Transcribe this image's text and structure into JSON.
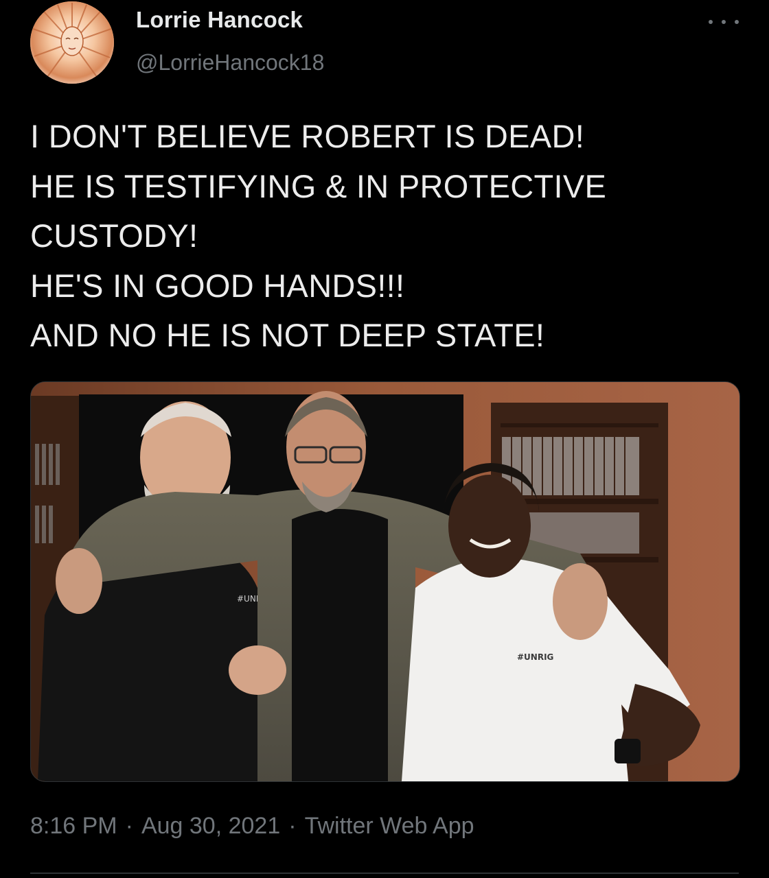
{
  "author": {
    "display_name": "Lorrie Hancock",
    "handle": "@LorrieHancock18",
    "avatar_icon": "woman-portrait-avatar"
  },
  "more_icon": "more-options-icon",
  "tweet": {
    "lines": [
      "I DON'T BELIEVE ROBERT IS DEAD!",
      "HE IS TESTIFYING & IN PROTECTIVE",
      "CUSTODY!",
      "HE'S IN GOOD HANDS!!!",
      "AND NO HE IS NOT DEEP STATE!"
    ]
  },
  "media": {
    "shirt_logo_left": "#UNRIG",
    "shirt_logo_right": "#UNRIG"
  },
  "meta": {
    "time": "8:16 PM",
    "date": "Aug 30, 2021",
    "source": "Twitter Web App",
    "separator": "·"
  },
  "colors": {
    "background": "#000000",
    "primary_text": "#e7e9ea",
    "secondary_text": "#71767b",
    "border": "#2f3336"
  }
}
